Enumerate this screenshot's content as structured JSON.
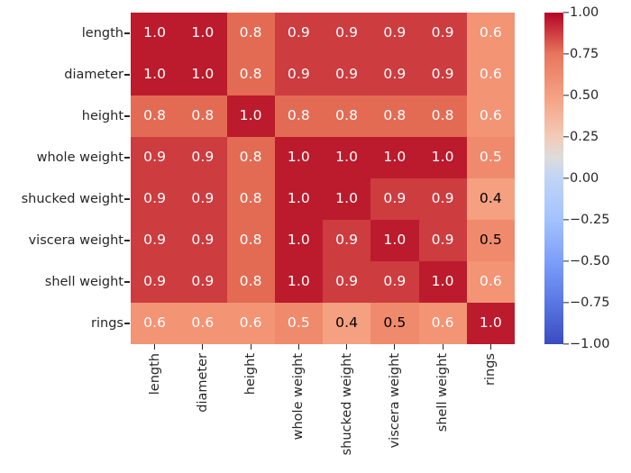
{
  "chart_data": {
    "type": "heatmap",
    "title": "",
    "xlabel": "",
    "ylabel": "",
    "categories": [
      "length",
      "diameter",
      "height",
      "whole weight",
      "shucked weight",
      "viscera weight",
      "shell weight",
      "rings"
    ],
    "x_tick_labels": [
      "length",
      "diameter",
      "height",
      "whole weight",
      "shucked weight",
      "viscera weight",
      "shell weight",
      "rings"
    ],
    "y_tick_labels": [
      "length",
      "diameter",
      "height",
      "whole weight",
      "shucked weight",
      "viscera weight",
      "shell weight",
      "rings"
    ],
    "colormap": "coolwarm",
    "vmin": -1.0,
    "vmax": 1.0,
    "annotated": true,
    "grid": false,
    "legend": "colorbar-right",
    "colorbar": {
      "ticks": [
        1.0,
        0.75,
        0.5,
        0.25,
        0.0,
        -0.25,
        -0.5,
        -0.75,
        -1.0
      ],
      "tick_labels": [
        "1.00",
        "0.75",
        "0.50",
        "0.25",
        "0.00",
        "−0.25",
        "−0.50",
        "−0.75",
        "−1.00"
      ],
      "min_color": "#3b4cc0",
      "mid_color": "#dddddd",
      "max_color": "#b40426"
    },
    "rows": [
      {
        "label": "length",
        "values": [
          1.0,
          1.0,
          0.8,
          0.9,
          0.9,
          0.9,
          0.9,
          0.6
        ],
        "annotations": [
          "1.0",
          "1.0",
          "0.8",
          "0.9",
          "0.9",
          "0.9",
          "0.9",
          "0.6"
        ]
      },
      {
        "label": "diameter",
        "values": [
          1.0,
          1.0,
          0.8,
          0.9,
          0.9,
          0.9,
          0.9,
          0.6
        ],
        "annotations": [
          "1.0",
          "1.0",
          "0.8",
          "0.9",
          "0.9",
          "0.9",
          "0.9",
          "0.6"
        ]
      },
      {
        "label": "height",
        "values": [
          0.8,
          0.8,
          1.0,
          0.8,
          0.8,
          0.8,
          0.8,
          0.6
        ],
        "annotations": [
          "0.8",
          "0.8",
          "1.0",
          "0.8",
          "0.8",
          "0.8",
          "0.8",
          "0.6"
        ]
      },
      {
        "label": "whole weight",
        "values": [
          0.9,
          0.9,
          0.8,
          1.0,
          1.0,
          1.0,
          1.0,
          0.5
        ],
        "annotations": [
          "0.9",
          "0.9",
          "0.8",
          "1.0",
          "1.0",
          "1.0",
          "1.0",
          "0.5"
        ]
      },
      {
        "label": "shucked weight",
        "values": [
          0.9,
          0.9,
          0.8,
          1.0,
          1.0,
          0.9,
          0.9,
          0.4
        ],
        "annotations": [
          "0.9",
          "0.9",
          "0.8",
          "1.0",
          "1.0",
          "0.9",
          "0.9",
          "0.4"
        ]
      },
      {
        "label": "viscera weight",
        "values": [
          0.9,
          0.9,
          0.8,
          1.0,
          0.9,
          1.0,
          0.9,
          0.5
        ],
        "annotations": [
          "0.9",
          "0.9",
          "0.8",
          "1.0",
          "0.9",
          "1.0",
          "0.9",
          "0.5"
        ]
      },
      {
        "label": "shell weight",
        "values": [
          0.9,
          0.9,
          0.8,
          1.0,
          0.9,
          0.9,
          1.0,
          0.6
        ],
        "annotations": [
          "0.9",
          "0.9",
          "0.8",
          "1.0",
          "0.9",
          "0.9",
          "1.0",
          "0.6"
        ]
      },
      {
        "label": "rings",
        "values": [
          0.6,
          0.6,
          0.6,
          0.5,
          0.4,
          0.5,
          0.6,
          1.0
        ],
        "annotations": [
          "0.6",
          "0.6",
          "0.6",
          "0.5",
          "0.4",
          "0.5",
          "0.6",
          "1.0"
        ]
      }
    ],
    "cell_colors": [
      [
        "#bb1b2c",
        "#bb1b2c",
        "#e36b54",
        "#cd3c3f",
        "#cd3c3f",
        "#cd3c3f",
        "#cd3c3f",
        "#f39475"
      ],
      [
        "#bb1b2c",
        "#bb1b2c",
        "#e36b54",
        "#cd3c3f",
        "#cd3c3f",
        "#cd3c3f",
        "#cd3c3f",
        "#f39475"
      ],
      [
        "#e36b54",
        "#e36b54",
        "#bb1b2c",
        "#e36b54",
        "#e36b54",
        "#e36b54",
        "#e36b54",
        "#f39475"
      ],
      [
        "#cd3c3f",
        "#cd3c3f",
        "#e36b54",
        "#bb1b2c",
        "#bb1b2c",
        "#bb1b2c",
        "#bb1b2c",
        "#f08a6c"
      ],
      [
        "#cd3c3f",
        "#cd3c3f",
        "#e36b54",
        "#bb1b2c",
        "#bb1b2c",
        "#cd3c3f",
        "#cd3c3f",
        "#f5a081"
      ],
      [
        "#cd3c3f",
        "#cd3c3f",
        "#e36b54",
        "#bb1b2c",
        "#cd3c3f",
        "#bb1b2c",
        "#cd3c3f",
        "#f08a6c"
      ],
      [
        "#cd3c3f",
        "#cd3c3f",
        "#e36b54",
        "#bb1b2c",
        "#cd3c3f",
        "#cd3c3f",
        "#bb1b2c",
        "#f39475"
      ],
      [
        "#f39475",
        "#f39475",
        "#f39475",
        "#f08a6c",
        "#f5a081",
        "#f08a6c",
        "#f39475",
        "#bb1b2c"
      ]
    ],
    "text_colors": [
      [
        "#ffffff",
        "#ffffff",
        "#ffffff",
        "#ffffff",
        "#ffffff",
        "#ffffff",
        "#ffffff",
        "#ffffff"
      ],
      [
        "#ffffff",
        "#ffffff",
        "#ffffff",
        "#ffffff",
        "#ffffff",
        "#ffffff",
        "#ffffff",
        "#ffffff"
      ],
      [
        "#ffffff",
        "#ffffff",
        "#ffffff",
        "#ffffff",
        "#ffffff",
        "#ffffff",
        "#ffffff",
        "#ffffff"
      ],
      [
        "#ffffff",
        "#ffffff",
        "#ffffff",
        "#ffffff",
        "#ffffff",
        "#ffffff",
        "#ffffff",
        "#ffffff"
      ],
      [
        "#ffffff",
        "#ffffff",
        "#ffffff",
        "#ffffff",
        "#ffffff",
        "#ffffff",
        "#ffffff",
        "#000000"
      ],
      [
        "#ffffff",
        "#ffffff",
        "#ffffff",
        "#ffffff",
        "#ffffff",
        "#ffffff",
        "#ffffff",
        "#000000"
      ],
      [
        "#ffffff",
        "#ffffff",
        "#ffffff",
        "#ffffff",
        "#ffffff",
        "#ffffff",
        "#ffffff",
        "#ffffff"
      ],
      [
        "#ffffff",
        "#ffffff",
        "#ffffff",
        "#ffffff",
        "#000000",
        "#000000",
        "#ffffff",
        "#ffffff"
      ]
    ]
  }
}
